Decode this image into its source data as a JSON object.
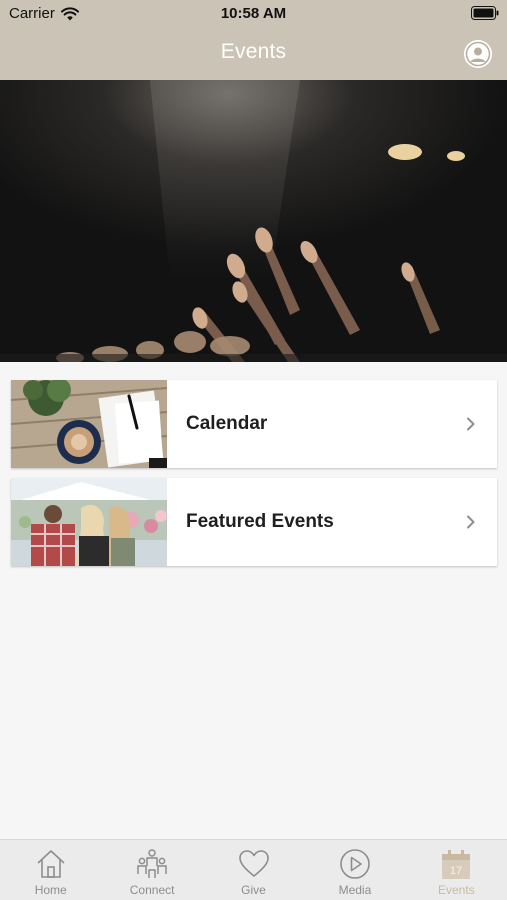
{
  "status_bar": {
    "carrier": "Carrier",
    "time": "10:58 AM"
  },
  "nav": {
    "title": "Events",
    "profile_icon": "user-avatar-icon"
  },
  "hero": {
    "description_icon": "concert-hands-image"
  },
  "cards": [
    {
      "label": "Calendar",
      "thumb_icon": "notebook-coffee-image"
    },
    {
      "label": "Featured Events",
      "thumb_icon": "crowd-outdoors-image"
    }
  ],
  "tab_bar": {
    "items": [
      {
        "label": "Home",
        "icon": "home-icon",
        "active": false
      },
      {
        "label": "Connect",
        "icon": "people-icon",
        "active": false
      },
      {
        "label": "Give",
        "icon": "heart-icon",
        "active": false
      },
      {
        "label": "Media",
        "icon": "play-circle-icon",
        "active": false
      },
      {
        "label": "Events",
        "icon": "calendar-icon",
        "active": true
      }
    ]
  },
  "colors": {
    "header_bg": "#cbc3b6",
    "page_bg": "#f6f6f6",
    "tab_active": "#c9b9a1",
    "tab_inactive": "#8d8d8d"
  }
}
